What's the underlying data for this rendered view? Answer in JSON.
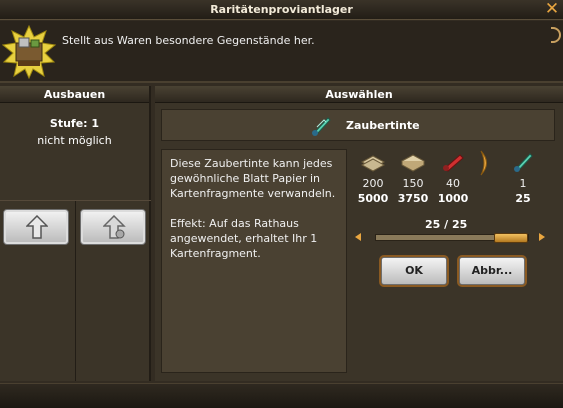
{
  "window": {
    "title": "Raritätenproviantlager",
    "description": "Stellt aus Waren besondere Gegenstände her."
  },
  "ausbauen": {
    "header": "Ausbauen",
    "stufe": "Stufe: 1",
    "status": "nicht möglich"
  },
  "auswaehlen": {
    "header": "Auswählen",
    "item_name": "Zaubertinte",
    "info_text_1": "Diese Zaubertinte kann jedes gewöhnliche Blatt Papier in Kartenfragmente verwandeln.",
    "info_text_2": "Effekt: Auf das Rathaus angewendet, erhaltet Ihr 1 Kartenfragment.",
    "costs": [
      {
        "icon": "paper-stack-icon",
        "amount": "200",
        "total": "5000"
      },
      {
        "icon": "parchment-icon",
        "amount": "150",
        "total": "3750"
      },
      {
        "icon": "red-ink-icon",
        "amount": "40",
        "total": "1000"
      }
    ],
    "result": {
      "icon": "quill-ink-icon",
      "amount": "1",
      "total": "25"
    },
    "quantity": "25 / 25",
    "slider_fraction": 1.0,
    "ok_label": "OK",
    "cancel_label": "Abbr..."
  },
  "colors": {
    "accent": "#e9a640",
    "panel": "#3b3428",
    "inner": "#4a4132"
  }
}
